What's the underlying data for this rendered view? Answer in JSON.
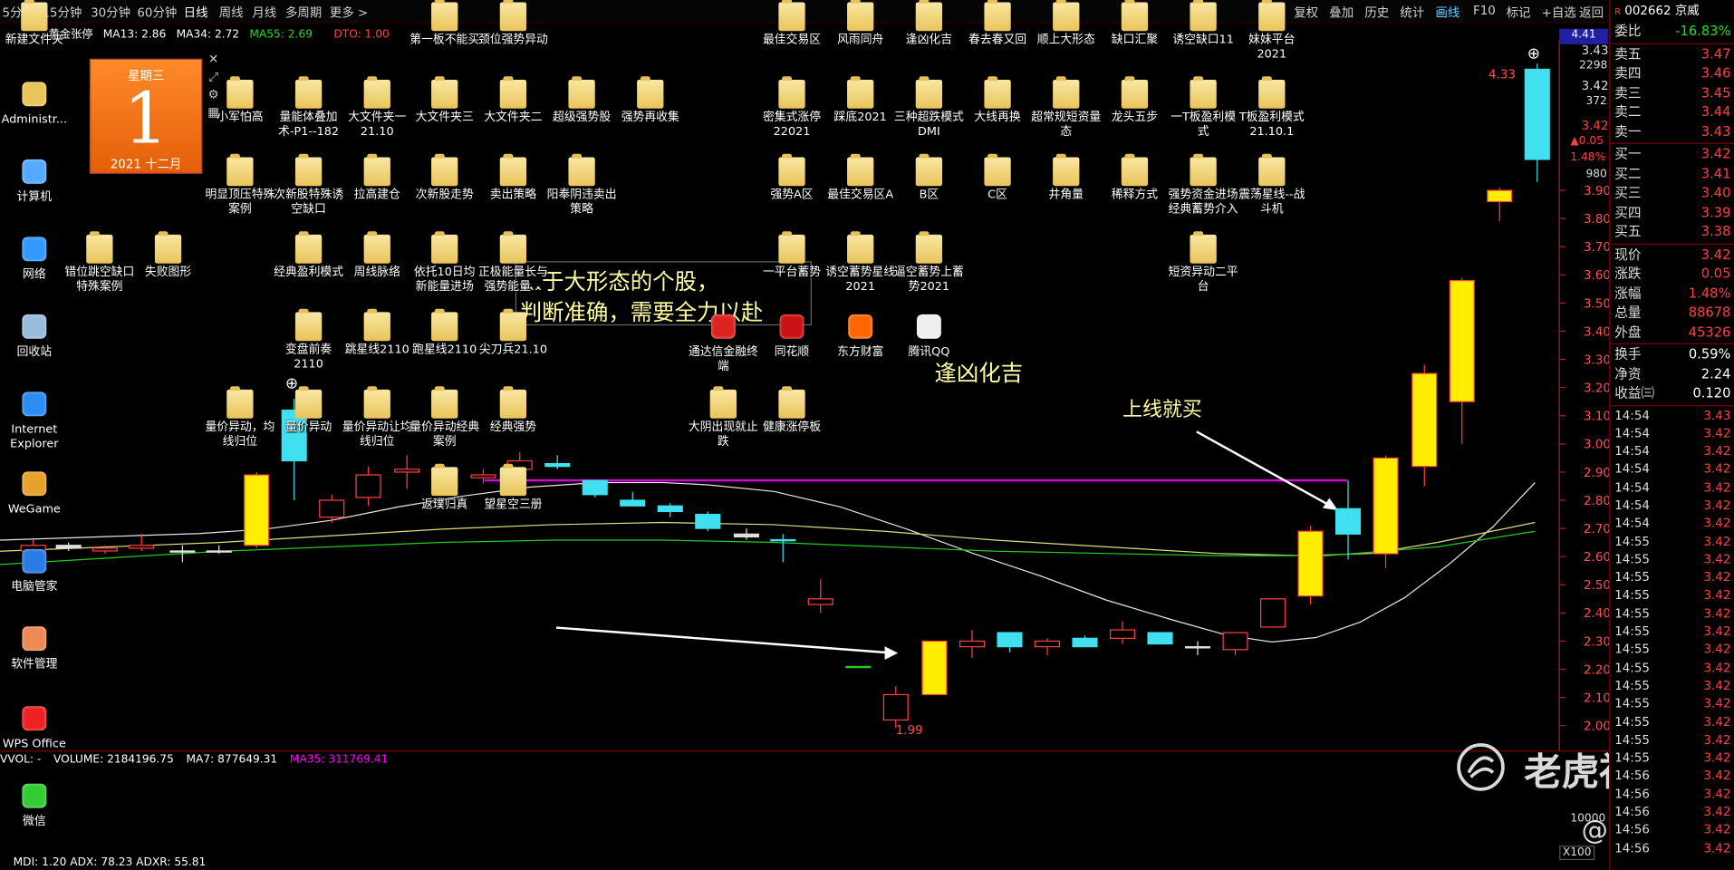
{
  "toolbar": {
    "periods": [
      "5分",
      "15分钟",
      "30分钟",
      "60分钟",
      "日线",
      "周线",
      "月线",
      "多周期",
      "更多 >"
    ],
    "active_period": "日线",
    "tools": [
      "复权",
      "叠加",
      "历史",
      "统计",
      "画线",
      "F10",
      "标记",
      "+自选",
      "返回"
    ],
    "active_tool": "画线"
  },
  "chart_header": {
    "name": "黄金张停",
    "ma13": "MA13: 2.86",
    "ma34": "MA34: 2.72",
    "ma55": "MA55: 2.69",
    "dto": "DTO: 1.00"
  },
  "indicator": {
    "label": "VVOL: -",
    "volume": "VOLUME: 2184196.75",
    "ma7": "MA7: 877649.31",
    "ma35": "MA35: 311769.41",
    "bottom": "MDI: 1.20  ADX: 78.23  ADXR: 55.81",
    "x100": "X100",
    "vol_tick": "10000"
  },
  "price_axis": [
    "3.90",
    "3.80",
    "3.70",
    "3.60",
    "3.50",
    "3.40",
    "3.30",
    "3.20",
    "3.10",
    "3.00",
    "2.90",
    "2.80",
    "2.70",
    "2.60",
    "2.50",
    "2.40",
    "2.30",
    "2.20",
    "2.10",
    "2.00"
  ],
  "axis_top": {
    "price": "4.41",
    "p1": "3.43",
    "v1": "2298",
    "p2": "3.42",
    "v2": "372",
    "p3": "3.42",
    "chg": "▲0.05",
    "pct": "1.48%",
    "vol": "980"
  },
  "chart_labels": {
    "high": "4.33",
    "low": "1.99"
  },
  "annotations": {
    "line1": "…于大形态的个股，",
    "line2": "判断准确，需要全力以赴",
    "luck": "逢凶化吉",
    "buy": "上线就买"
  },
  "quote": {
    "code": "002662",
    "name": "京威",
    "ratio_label": "委比",
    "ratio": "-16.83%",
    "asks": [
      {
        "label": "卖五",
        "price": "3.47"
      },
      {
        "label": "卖四",
        "price": "3.46"
      },
      {
        "label": "卖三",
        "price": "3.45"
      },
      {
        "label": "卖二",
        "price": "3.44"
      },
      {
        "label": "卖一",
        "price": "3.43"
      }
    ],
    "bids": [
      {
        "label": "买一",
        "price": "3.42"
      },
      {
        "label": "买二",
        "price": "3.41"
      },
      {
        "label": "买三",
        "price": "3.40"
      },
      {
        "label": "买四",
        "price": "3.39"
      },
      {
        "label": "买五",
        "price": "3.38"
      }
    ],
    "stats": [
      {
        "label": "现价",
        "value": "3.42"
      },
      {
        "label": "涨跌",
        "value": "0.05"
      },
      {
        "label": "涨幅",
        "value": "1.48%"
      },
      {
        "label": "总量",
        "value": "88678"
      },
      {
        "label": "外盘",
        "value": "45326"
      }
    ],
    "stats2": [
      {
        "label": "换手",
        "value": "0.59%"
      },
      {
        "label": "净资",
        "value": "2.24"
      },
      {
        "label": "收益㈢",
        "value": "0.120"
      }
    ],
    "ticks": [
      {
        "t": "14:54",
        "p": "3.43"
      },
      {
        "t": "14:54",
        "p": "3.42"
      },
      {
        "t": "14:54",
        "p": "3.42"
      },
      {
        "t": "14:54",
        "p": "3.42"
      },
      {
        "t": "14:54",
        "p": "3.42"
      },
      {
        "t": "14:54",
        "p": "3.42"
      },
      {
        "t": "14:54",
        "p": "3.42"
      },
      {
        "t": "14:55",
        "p": "3.42"
      },
      {
        "t": "14:55",
        "p": "3.42"
      },
      {
        "t": "14:55",
        "p": "3.42"
      },
      {
        "t": "14:55",
        "p": "3.42"
      },
      {
        "t": "14:55",
        "p": "3.42"
      },
      {
        "t": "14:55",
        "p": "3.42"
      },
      {
        "t": "14:55",
        "p": "3.42"
      },
      {
        "t": "14:55",
        "p": "3.42"
      },
      {
        "t": "14:55",
        "p": "3.42"
      },
      {
        "t": "14:55",
        "p": "3.42"
      },
      {
        "t": "14:55",
        "p": "3.42"
      },
      {
        "t": "14:55",
        "p": "3.42"
      },
      {
        "t": "14:55",
        "p": "3.42"
      },
      {
        "t": "14:56",
        "p": "3.42"
      },
      {
        "t": "14:56",
        "p": "3.42"
      },
      {
        "t": "14:56",
        "p": "3.42"
      },
      {
        "t": "14:56",
        "p": "3.42"
      },
      {
        "t": "14:56",
        "p": "3.42"
      }
    ]
  },
  "calendar": {
    "weekday": "星期三",
    "day": "1",
    "month": "2021 十二月"
  },
  "desktop_left": [
    {
      "label": "新建文件夹",
      "icon": "folder-icon"
    },
    {
      "label": "Administr...",
      "icon": "user-folder-icon"
    },
    {
      "label": "计算机",
      "icon": "computer-icon"
    },
    {
      "label": "网络",
      "icon": "network-icon"
    },
    {
      "label": "回收站",
      "icon": "recycle-bin-icon"
    },
    {
      "label": "Internet Explorer",
      "icon": "ie-icon"
    },
    {
      "label": "WeGame",
      "icon": "wegame-icon"
    },
    {
      "label": "电脑管家",
      "icon": "pc-manager-icon"
    },
    {
      "label": "软件管理",
      "icon": "software-manager-icon"
    },
    {
      "label": "WPS Office",
      "icon": "wps-icon"
    },
    {
      "label": "微信",
      "icon": "wechat-icon"
    }
  ],
  "desktop_icons": [
    {
      "label": "第一板不能买",
      "icon": "folder-icon"
    },
    {
      "label": "颈位强势异动",
      "icon": "folder-icon"
    },
    {
      "label": "最佳交易区",
      "icon": "folder-icon"
    },
    {
      "label": "风雨同舟",
      "icon": "folder-icon"
    },
    {
      "label": "逢凶化吉",
      "icon": "folder-icon"
    },
    {
      "label": "春去春又回",
      "icon": "folder-icon"
    },
    {
      "label": "顺上大形态",
      "icon": "folder-icon"
    },
    {
      "label": "缺口汇聚",
      "icon": "folder-icon"
    },
    {
      "label": "诱空缺口11",
      "icon": "folder-icon"
    },
    {
      "label": "妹妹平台2021",
      "icon": "folder-icon"
    },
    {
      "label": "小军怕高",
      "icon": "folder-icon"
    },
    {
      "label": "量能体叠加术-P1--182",
      "icon": "folder-icon"
    },
    {
      "label": "大文件夹一21.10",
      "icon": "folder-icon"
    },
    {
      "label": "大文件夹三",
      "icon": "folder-icon"
    },
    {
      "label": "大文件夹二",
      "icon": "folder-shortcut-icon"
    },
    {
      "label": "超级强势股",
      "icon": "folder-icon"
    },
    {
      "label": "强势再收集",
      "icon": "folder-icon"
    },
    {
      "label": "密集式涨停22021",
      "icon": "folder-icon"
    },
    {
      "label": "踩底2021",
      "icon": "folder-icon"
    },
    {
      "label": "三种超跌模式DMI",
      "icon": "folder-icon"
    },
    {
      "label": "大线再换",
      "icon": "folder-icon"
    },
    {
      "label": "超常规短资量态",
      "icon": "folder-icon"
    },
    {
      "label": "龙头五步",
      "icon": "folder-icon"
    },
    {
      "label": "一T板盈利模式",
      "icon": "folder-icon"
    },
    {
      "label": "T板盈利模式21.10.1",
      "icon": "folder-icon"
    },
    {
      "label": "明显顶压特殊案例",
      "icon": "folder-icon"
    },
    {
      "label": "次新股特殊诱空缺口",
      "icon": "folder-icon"
    },
    {
      "label": "拉高建仓",
      "icon": "folder-icon"
    },
    {
      "label": "次新股走势",
      "icon": "folder-icon"
    },
    {
      "label": "卖出策略",
      "icon": "folder-icon"
    },
    {
      "label": "阳奉阴违卖出策略",
      "icon": "folder-icon"
    },
    {
      "label": "强势A区",
      "icon": "folder-icon"
    },
    {
      "label": "最佳交易区A",
      "icon": "folder-icon"
    },
    {
      "label": "B区",
      "icon": "folder-icon"
    },
    {
      "label": "C区",
      "icon": "folder-icon"
    },
    {
      "label": "井角量",
      "icon": "folder-icon"
    },
    {
      "label": "稀释方式",
      "icon": "folder-icon"
    },
    {
      "label": "强势资金进场经典蓄势介入",
      "icon": "folder-icon"
    },
    {
      "label": "震荡星线--战斗机",
      "icon": "folder-icon"
    },
    {
      "label": "错位跳空缺口特殊案例",
      "icon": "folder-icon"
    },
    {
      "label": "失败图形",
      "icon": "folder-icon"
    },
    {
      "label": "经典盈利模式",
      "icon": "folder-icon"
    },
    {
      "label": "周线脉络",
      "icon": "folder-icon"
    },
    {
      "label": "依托10日均新能量进场",
      "icon": "folder-icon"
    },
    {
      "label": "正极能量长与强势能量...",
      "icon": "folder-icon"
    },
    {
      "label": "一平台蓄势",
      "icon": "folder-icon"
    },
    {
      "label": "诱空蓄势星线2021",
      "icon": "folder-icon"
    },
    {
      "label": "逼空蓄势上蓄势2021",
      "icon": "folder-icon"
    },
    {
      "label": "短资异动二平台",
      "icon": "folder-icon"
    },
    {
      "label": "变盘前奏2110",
      "icon": "folder-icon"
    },
    {
      "label": "跳星线2110",
      "icon": "folder-icon"
    },
    {
      "label": "跑星线2110",
      "icon": "folder-icon"
    },
    {
      "label": "尖刀兵21.10",
      "icon": "folder-icon"
    },
    {
      "label": "通达信金融终端",
      "icon": "tdx-icon"
    },
    {
      "label": "同花顺",
      "icon": "ths-icon"
    },
    {
      "label": "东方财富",
      "icon": "eastmoney-icon"
    },
    {
      "label": "腾讯QQ",
      "icon": "qq-icon"
    },
    {
      "label": "量价异动，均线归位",
      "icon": "folder-icon"
    },
    {
      "label": "量价异动",
      "icon": "folder-icon"
    },
    {
      "label": "量价异动让均线归位",
      "icon": "folder-icon"
    },
    {
      "label": "量价异动经典案例",
      "icon": "folder-icon"
    },
    {
      "label": "经典强势",
      "icon": "folder-icon"
    },
    {
      "label": "大阴出现就止跌",
      "icon": "folder-icon"
    },
    {
      "label": "健康涨停板",
      "icon": "folder-icon"
    },
    {
      "label": "返璞归真",
      "icon": "folder-icon"
    },
    {
      "label": "望星空三册",
      "icon": "folder-icon"
    }
  ],
  "watermark": {
    "brand": "老虎社区",
    "author": "@少数派"
  }
}
